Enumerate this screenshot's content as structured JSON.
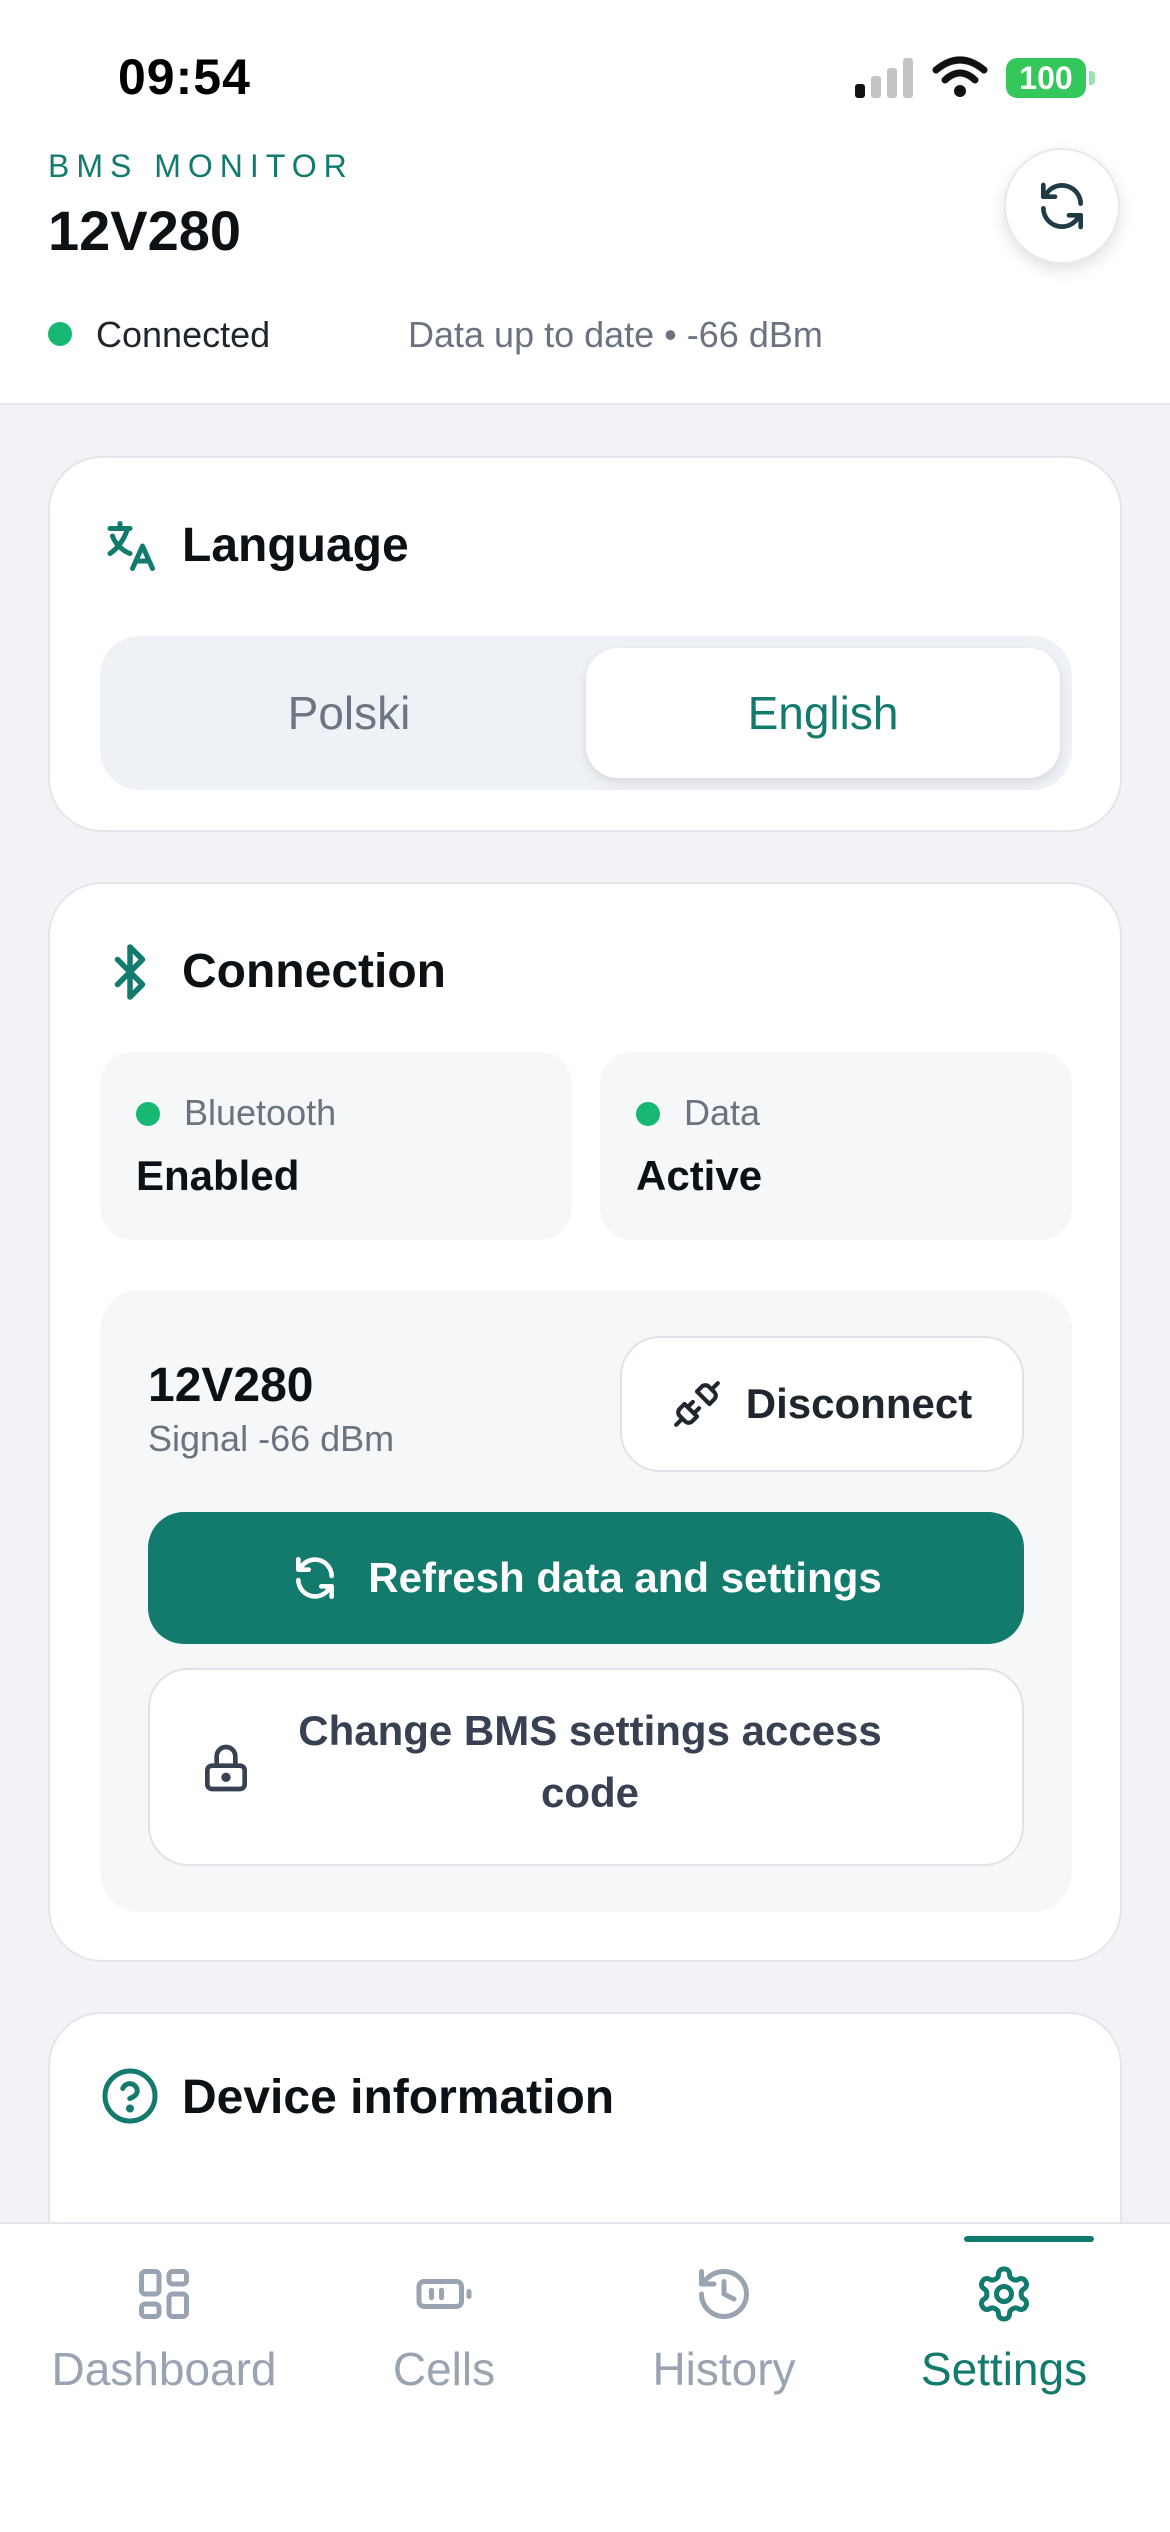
{
  "status_bar": {
    "time": "09:54",
    "battery": "100"
  },
  "header": {
    "brand": "BMS MONITOR",
    "device_name": "12V280",
    "connection_status": "Connected",
    "connection_info": "Data up to date • -66 dBm"
  },
  "language_card": {
    "title": "Language",
    "options": [
      "Polski",
      "English"
    ],
    "selected": "English"
  },
  "connection_card": {
    "title": "Connection",
    "bluetooth": {
      "label": "Bluetooth",
      "value": "Enabled"
    },
    "data": {
      "label": "Data",
      "value": "Active"
    },
    "device": {
      "name": "12V280",
      "signal": "Signal -66 dBm",
      "disconnect_label": "Disconnect",
      "refresh_label": "Refresh data and settings",
      "change_code_label": "Change BMS settings access code"
    }
  },
  "device_info_card": {
    "title": "Device information"
  },
  "tabs": [
    {
      "label": "Dashboard",
      "icon": "grid-icon"
    },
    {
      "label": "Cells",
      "icon": "battery-icon"
    },
    {
      "label": "History",
      "icon": "history-icon"
    },
    {
      "label": "Settings",
      "icon": "gear-icon",
      "active": true
    }
  ],
  "colors": {
    "accent": "#137a6e",
    "status_green": "#16b874",
    "battery_green": "#34c759"
  }
}
